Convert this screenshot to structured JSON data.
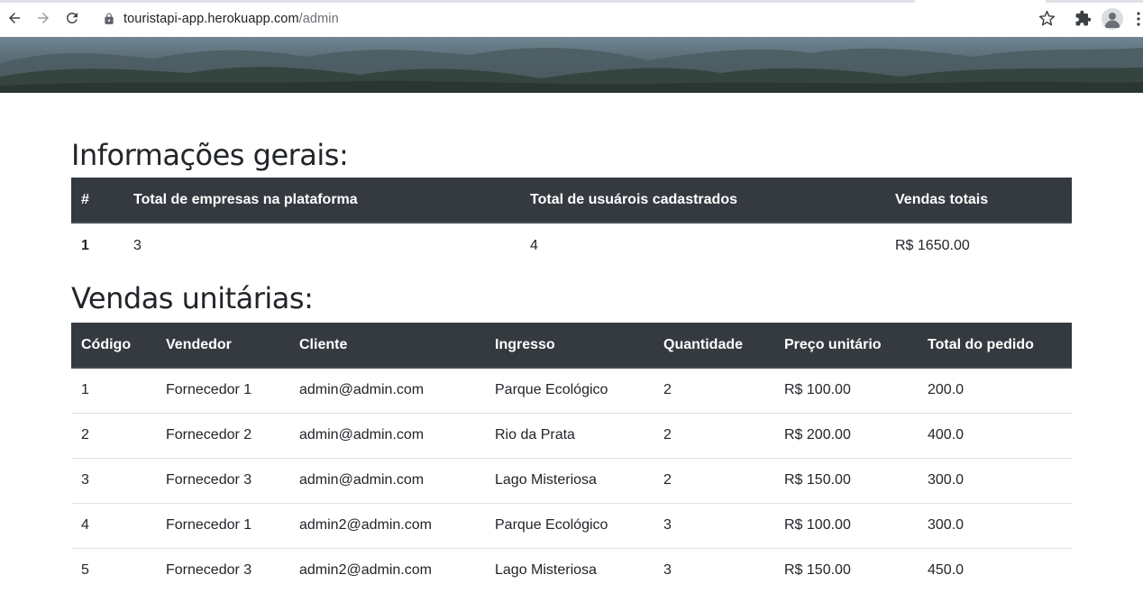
{
  "browser": {
    "url_host": "touristapi-app.herokuapp.com",
    "url_path": "/admin"
  },
  "colors": {
    "table_header_bg": "#343a40",
    "table_header_text": "#ffffff",
    "row_border": "#dee2e6"
  },
  "icons": [
    "back-arrow-icon",
    "forward-arrow-icon",
    "reload-icon",
    "lock-icon",
    "star-icon",
    "puzzle-icon",
    "avatar",
    "kebab-menu-icon"
  ],
  "general_info": {
    "title": "Informações gerais:",
    "columns": [
      "#",
      "Total de empresas na plataforma",
      "Total de usuárois cadastrados",
      "Vendas totais"
    ],
    "rows": [
      [
        "1",
        "3",
        "4",
        "R$ 1650.00"
      ]
    ]
  },
  "unit_sales": {
    "title": "Vendas unitárias:",
    "columns": [
      "Código",
      "Vendedor",
      "Cliente",
      "Ingresso",
      "Quantidade",
      "Preço unitário",
      "Total do pedido"
    ],
    "rows": [
      [
        "1",
        "Fornecedor 1",
        "admin@admin.com",
        "Parque Ecológico",
        "2",
        "R$ 100.00",
        "200.0"
      ],
      [
        "2",
        "Fornecedor 2",
        "admin@admin.com",
        "Rio da Prata",
        "2",
        "R$ 200.00",
        "400.0"
      ],
      [
        "3",
        "Fornecedor 3",
        "admin@admin.com",
        "Lago Misteriosa",
        "2",
        "R$ 150.00",
        "300.0"
      ],
      [
        "4",
        "Fornecedor 1",
        "admin2@admin.com",
        "Parque Ecológico",
        "3",
        "R$ 100.00",
        "300.0"
      ],
      [
        "5",
        "Fornecedor 3",
        "admin2@admin.com",
        "Lago Misteriosa",
        "3",
        "R$ 150.00",
        "450.0"
      ]
    ]
  }
}
